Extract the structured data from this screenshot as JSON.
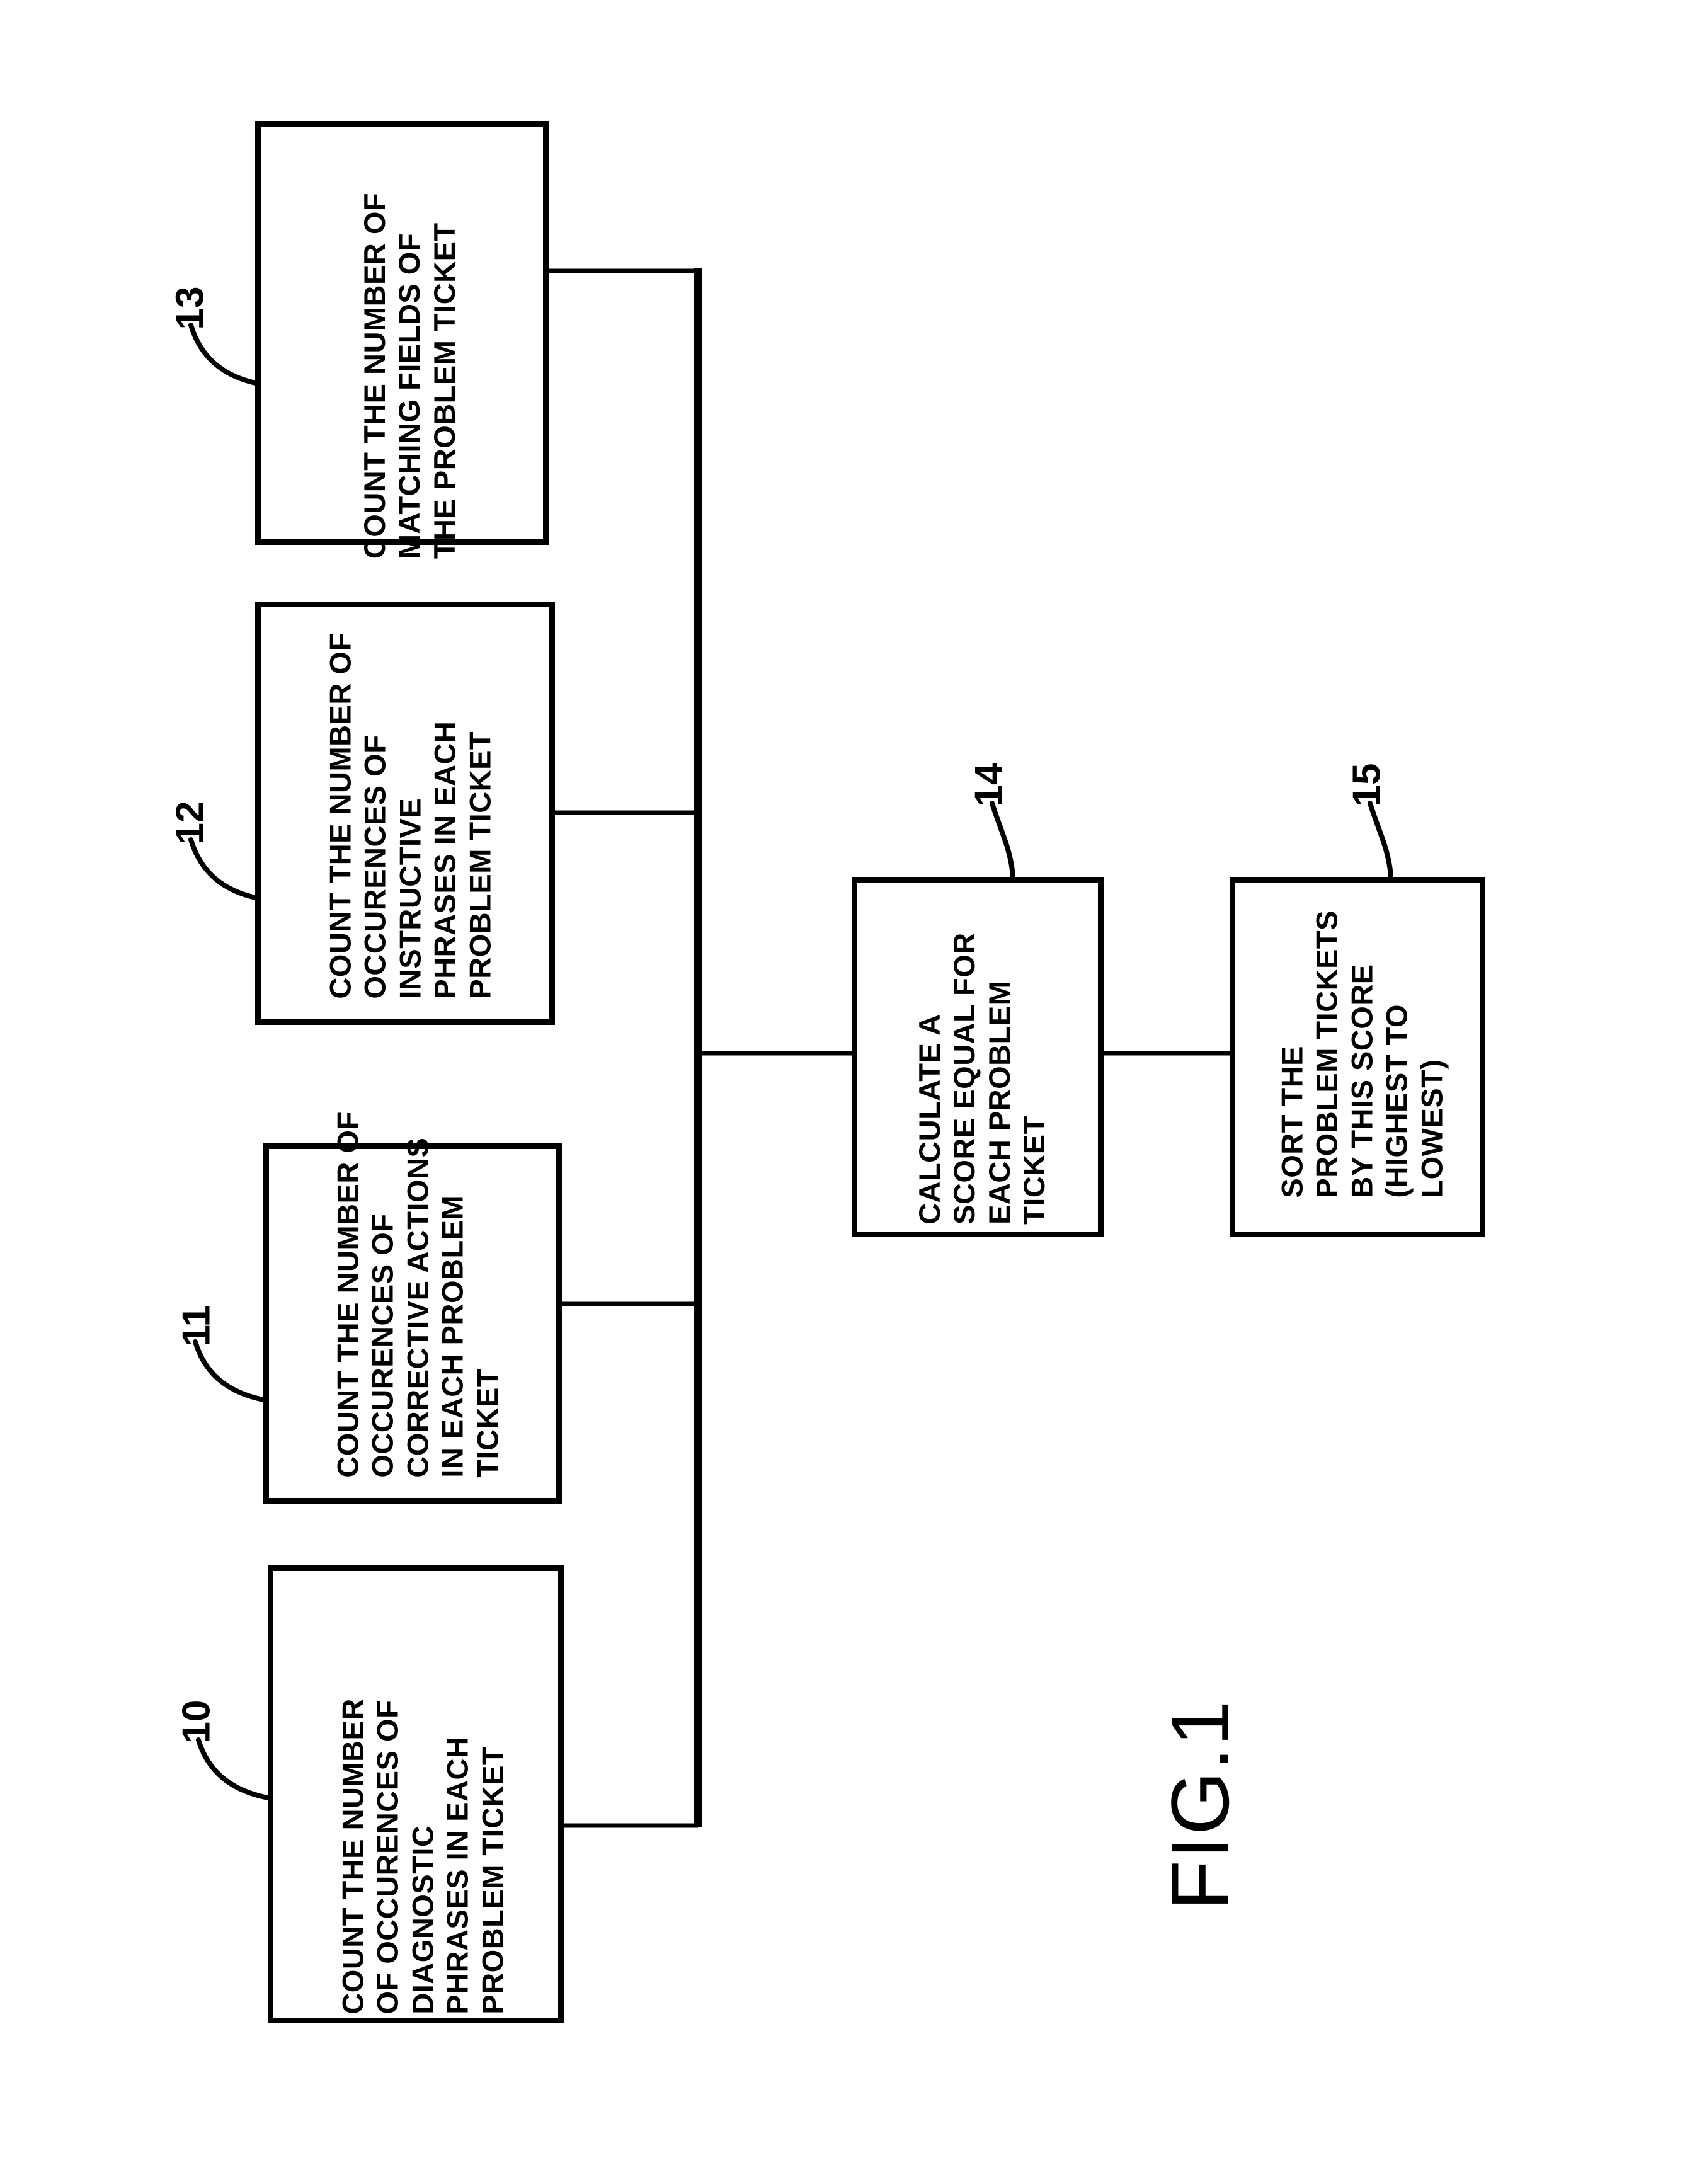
{
  "figure": {
    "caption": "FIG.1",
    "orientation": "landscape-rotated-90"
  },
  "nodes": [
    {
      "ref": "13",
      "name": "count-matching-fields",
      "text": "COUNT THE NUMBER OF\nMATCHING FIELDS OF\nTHE PROBLEM TICKET"
    },
    {
      "ref": "12",
      "name": "count-instructive-phrases",
      "text": "COUNT THE NUMBER OF\nOCCURENCES OF\nINSTRUCTIVE\nPHRASES IN EACH\nPROBLEM TICKET"
    },
    {
      "ref": "11",
      "name": "count-corrective-actions",
      "text": "COUNT THE NUMBER OF\nOCCURENCES OF\nCORRECTIVE ACTIONS\nIN EACH PROBLEM\nTICKET"
    },
    {
      "ref": "10",
      "name": "count-diagnostic-phrases",
      "text": "COUNT THE NUMBER\nOF OCCURENCES OF\nDIAGNOSTIC\nPHRASES IN EACH\nPROBLEM TICKET"
    },
    {
      "ref": "14",
      "name": "calculate-score",
      "text": "CALCULATE A\nSCORE EQUAL FOR\nEACH PROBLEM\nTICKET"
    },
    {
      "ref": "15",
      "name": "sort-problem-tickets",
      "text": "SORT THE\nPROBLEM TICKETS\nBY THIS SCORE\n(HIGHEST TO\nLOWEST)"
    }
  ],
  "colors": {
    "ink": "#000000",
    "paper": "#ffffff"
  }
}
